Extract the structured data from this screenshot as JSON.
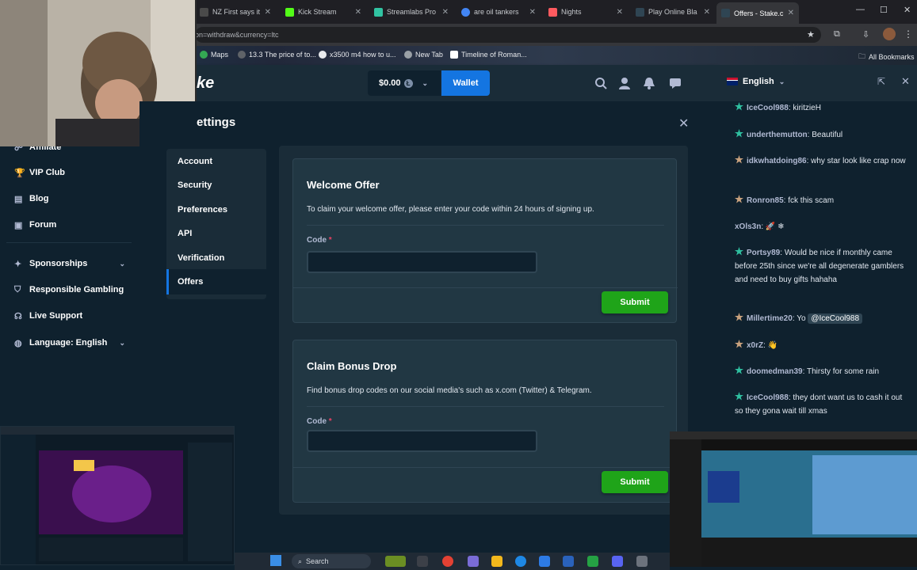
{
  "browser": {
    "tabs": [
      {
        "label": "NZ First says it",
        "color": "#4a4a4a"
      },
      {
        "label": "Kick Stream",
        "color": "#53fc18"
      },
      {
        "label": "Streamlabs Pro",
        "color": "#31c3a2"
      },
      {
        "label": "are oil tankers",
        "color": "#4285f4"
      },
      {
        "label": "Nights",
        "color": "#ff5a5f"
      },
      {
        "label": "Play Online Bla",
        "color": "#2f4553"
      },
      {
        "label": "Offers - Stake.c",
        "color": "#2f4553"
      }
    ],
    "url": "on=withdraw&currency=ltc",
    "bookmarks": [
      "Maps",
      "13.3 The price of to...",
      "x3500 m4 how to u...",
      "New Tab",
      "Timeline of Roman..."
    ],
    "all_bookmarks": "All Bookmarks"
  },
  "header": {
    "logo_fragment": "ke",
    "balance": "$0.00",
    "currency_symbol": "Ł",
    "wallet_label": "Wallet"
  },
  "sidebar": {
    "items": [
      {
        "label": "Affiliate",
        "icon": "affiliate-icon"
      },
      {
        "label": "VIP Club",
        "icon": "trophy-icon"
      },
      {
        "label": "Blog",
        "icon": "blog-icon"
      },
      {
        "label": "Forum",
        "icon": "forum-icon"
      },
      {
        "label": "Sponsorships",
        "icon": "sponsorship-icon"
      },
      {
        "label": "Responsible Gambling",
        "icon": "shield-icon"
      },
      {
        "label": "Live Support",
        "icon": "headset-icon"
      },
      {
        "label": "Language: English",
        "icon": "globe-icon"
      }
    ]
  },
  "settings": {
    "title": "ettings",
    "nav": [
      "Account",
      "Security",
      "Preferences",
      "API",
      "Verification",
      "Offers"
    ],
    "active_nav": "Offers",
    "welcome": {
      "title": "Welcome Offer",
      "description": "To claim your welcome offer, please enter your code within 24 hours of signing up.",
      "code_label": "Code",
      "required_mark": "*",
      "code_value": "",
      "submit": "Submit"
    },
    "bonus": {
      "title": "Claim Bonus Drop",
      "description": "Find bonus drop codes on our social media's such as x.com (Twitter) & Telegram.",
      "code_label": "Code",
      "required_mark": "*",
      "code_value": "",
      "submit": "Submit"
    }
  },
  "chat": {
    "language": "English",
    "messages": [
      {
        "user": "IceCool988",
        "text": "kiritzieH",
        "star": "#2fbfa0"
      },
      {
        "user": "underthemutton",
        "text": "Beautiful",
        "star": "#2fbfa0"
      },
      {
        "user": "idkwhatdoing86",
        "text": "why star look like crap now",
        "star": "#c9a27e"
      },
      {
        "user": "Ronron85",
        "text": "fck this scam",
        "star": "#c9a27e"
      },
      {
        "user": "xOls3n",
        "text": "🚀 ❄",
        "star": ""
      },
      {
        "user": "Portsy89",
        "text": "Would be nice if monthly came before 25th since we're all degenerate gamblers and need to buy gifts hahaha",
        "star": "#2fbfa0"
      },
      {
        "user": "Millertime20",
        "text": "Yo",
        "mention": "@IceCool988",
        "star": "#c9a27e"
      },
      {
        "user": "x0rZ",
        "text": "👋",
        "star": "#c9a27e"
      },
      {
        "user": "doomedman39",
        "text": "Thirsty for some rain",
        "star": "#2fbfa0"
      },
      {
        "user": "IceCool988",
        "text": "they dont want us to cash it out so they gona wait till xmas",
        "star": "#2fbfa0"
      }
    ]
  },
  "taskbar": {
    "search_label": "Search"
  },
  "colors": {
    "bg": "#0f212e",
    "panel": "#1a2c38",
    "card": "#213743",
    "accent_blue": "#1475e1",
    "accent_green": "#1fa419"
  }
}
